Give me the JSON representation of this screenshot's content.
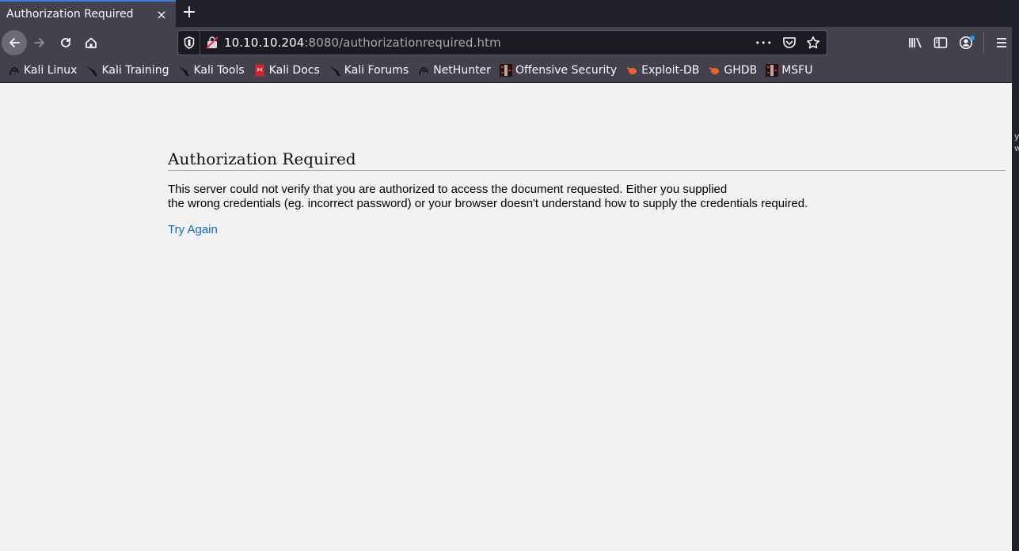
{
  "browser": {
    "tab": {
      "title": "Authorization Required",
      "close_glyph": "×"
    },
    "new_tab_glyph": "+",
    "url": {
      "host": "10.10.10.204",
      "rest": ":8080/authorizationrequired.htm"
    },
    "url_more_glyph": "•••",
    "accent_color": "#3f7be8"
  },
  "bookmarks": [
    {
      "label": "Kali Linux",
      "icon": "kali-dragon-icon"
    },
    {
      "label": "Kali Training",
      "icon": "kali-knife-icon"
    },
    {
      "label": "Kali Tools",
      "icon": "kali-knife-icon"
    },
    {
      "label": "Kali Docs",
      "icon": "kali-docs-icon"
    },
    {
      "label": "Kali Forums",
      "icon": "kali-knife-icon"
    },
    {
      "label": "NetHunter",
      "icon": "kali-dragon-icon"
    },
    {
      "label": "Offensive Security",
      "icon": "offsec-icon"
    },
    {
      "label": "Exploit-DB",
      "icon": "exploitdb-icon"
    },
    {
      "label": "GHDB",
      "icon": "exploitdb-icon"
    },
    {
      "label": "MSFU",
      "icon": "offsec-icon"
    }
  ],
  "page": {
    "heading": "Authorization Required",
    "message_line1": "This server could not verify that you are authorized to access the document requested. Either you supplied",
    "message_line2": "the wrong credentials (eg. incorrect password) or your browser doesn't understand how to supply the credentials required.",
    "link": "Try Again",
    "link_color": "#0b6cc6"
  },
  "side_strip": {
    "chars": [
      "y",
      "w"
    ]
  }
}
